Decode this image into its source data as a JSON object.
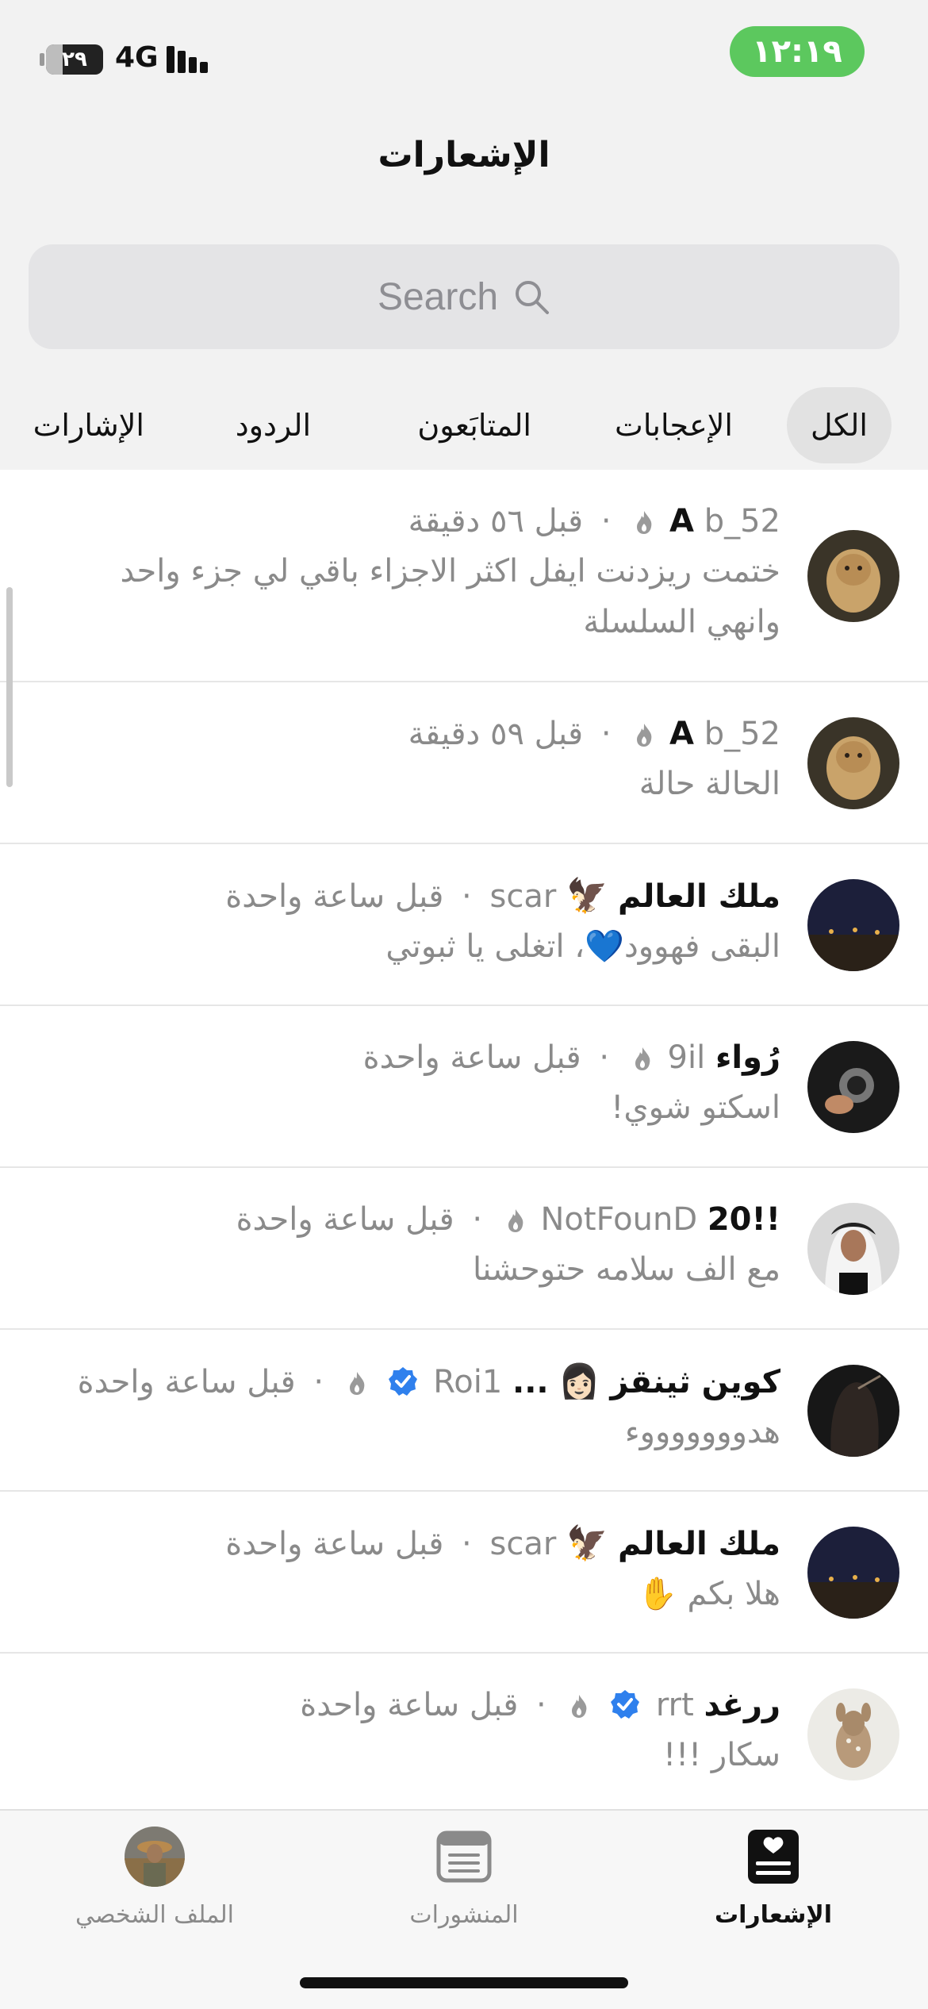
{
  "status_bar": {
    "time": "١٢:١٩",
    "network": "4G",
    "battery": "٢٩",
    "battery_level": 0.29
  },
  "header": {
    "title": "الإشعارات"
  },
  "search": {
    "placeholder": "Search"
  },
  "tabs": [
    {
      "label": "الكل",
      "active": true
    },
    {
      "label": "الإعجابات",
      "active": false
    },
    {
      "label": "المتابَعون",
      "active": false
    },
    {
      "label": "الردود",
      "active": false
    },
    {
      "label": "الإشارات",
      "active": false
    }
  ],
  "notifications": [
    {
      "name": "A",
      "handle": "b_52",
      "flame": true,
      "verified": false,
      "time": "قبل ٥٦ دقيقة",
      "text": "ختمت ريزدنت ايفل اكثر الاجزاء باقي لي جزء واحد وانهي السلسلة",
      "avatar": "lion-cub"
    },
    {
      "name": "A",
      "handle": "b_52",
      "flame": true,
      "verified": false,
      "time": "قبل ٥٩ دقيقة",
      "text": "الحالة حالة",
      "avatar": "lion-cub"
    },
    {
      "name": "ملك العالم",
      "name_emoji": "🦅",
      "handle": "scar",
      "flame": false,
      "verified": false,
      "time": "قبل ساعة واحدة",
      "text": "البقى فهوود💙، اتغلى يا ثبوتي",
      "avatar": "night-road"
    },
    {
      "name": "رُواء",
      "handle": "9il",
      "flame": true,
      "verified": false,
      "time": "قبل ساعة واحدة",
      "text": "اسكتو شوي!",
      "avatar": "camera-hands"
    },
    {
      "name": "!!20",
      "handle": "NotFounD",
      "flame": true,
      "verified": false,
      "time": "قبل ساعة واحدة",
      "text": "مع الف سلامه حتوحشنا",
      "avatar": "man-ghutra"
    },
    {
      "name": "كوين ثينقز",
      "name_emoji": "👩🏻",
      "ellipsis": "...",
      "handle": "Roi1",
      "flame": true,
      "verified": true,
      "time": "قبل ساعة واحدة",
      "text": "هدوووووووء",
      "avatar": "dark-hair"
    },
    {
      "name": "ملك العالم",
      "name_emoji": "🦅",
      "handle": "scar",
      "flame": false,
      "verified": false,
      "time": "قبل ساعة واحدة",
      "text": "هلا بكم ✋",
      "avatar": "night-road"
    },
    {
      "name": "ررغد",
      "handle": "rrt",
      "flame": true,
      "verified": true,
      "time": "قبل ساعة واحدة",
      "text": "سكار !!!",
      "avatar": "fawn"
    }
  ],
  "bottom_nav": [
    {
      "label": "الإشعارات",
      "icon": "notifications-heart-icon",
      "active": true
    },
    {
      "label": "المنشورات",
      "icon": "posts-icon",
      "active": false
    },
    {
      "label": "الملف الشخصي",
      "icon": "profile-avatar",
      "active": false
    }
  ],
  "colors": {
    "status_green": "#5cc85e",
    "verified_blue": "#2f80ed",
    "secondary_text": "#8a8a8a"
  }
}
